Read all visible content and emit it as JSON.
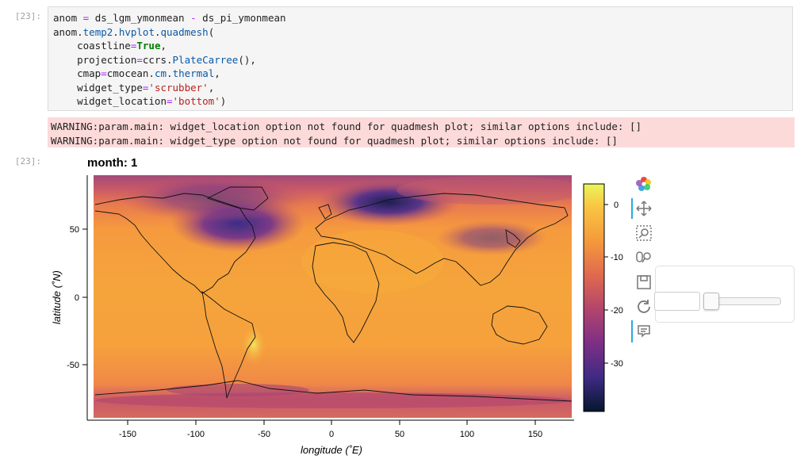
{
  "cells": {
    "input_prompt": "[23]:",
    "output_prompt": "[23]:",
    "code_lines": [
      "anom = ds_lgm_ymonmean - ds_pi_ymonmean",
      "anom.temp2.hvplot.quadmesh(",
      "    coastline=True,",
      "    projection=ccrs.PlateCarree(),",
      "    cmap=cmocean.cm.thermal,",
      "    widget_type='scrubber',",
      "    widget_location='bottom')"
    ],
    "warnings": [
      "WARNING:param.main: widget_location option not found for quadmesh plot; similar options include: []",
      "WARNING:param.main: widget_type option not found for quadmesh plot; similar options include: []"
    ]
  },
  "plot": {
    "title": "month: 1",
    "xlabel": "longitude (˚E)",
    "ylabel": "latitude (˚N)",
    "x_ticks": [
      "-150",
      "-100",
      "-50",
      "0",
      "50",
      "100",
      "150"
    ],
    "y_ticks": [
      "50",
      "0",
      "-50"
    ],
    "colorbar_ticks": [
      "0",
      "-10",
      "-20",
      "-30"
    ]
  },
  "toolbar": {
    "icons": [
      "bokeh-logo-icon",
      "pan-icon",
      "box-zoom-icon",
      "wheel-zoom-icon",
      "save-icon",
      "reset-icon",
      "hover-icon"
    ]
  },
  "widget": {
    "slider_value": 0
  },
  "chart_data": {
    "type": "heatmap",
    "title": "month: 1",
    "xlabel": "longitude (˚E)",
    "ylabel": "latitude (˚N)",
    "xlim": [
      -180,
      180
    ],
    "ylim": [
      -90,
      90
    ],
    "colorbar_range": [
      -35,
      3
    ],
    "colormap": "thermal",
    "coastline": true
  }
}
